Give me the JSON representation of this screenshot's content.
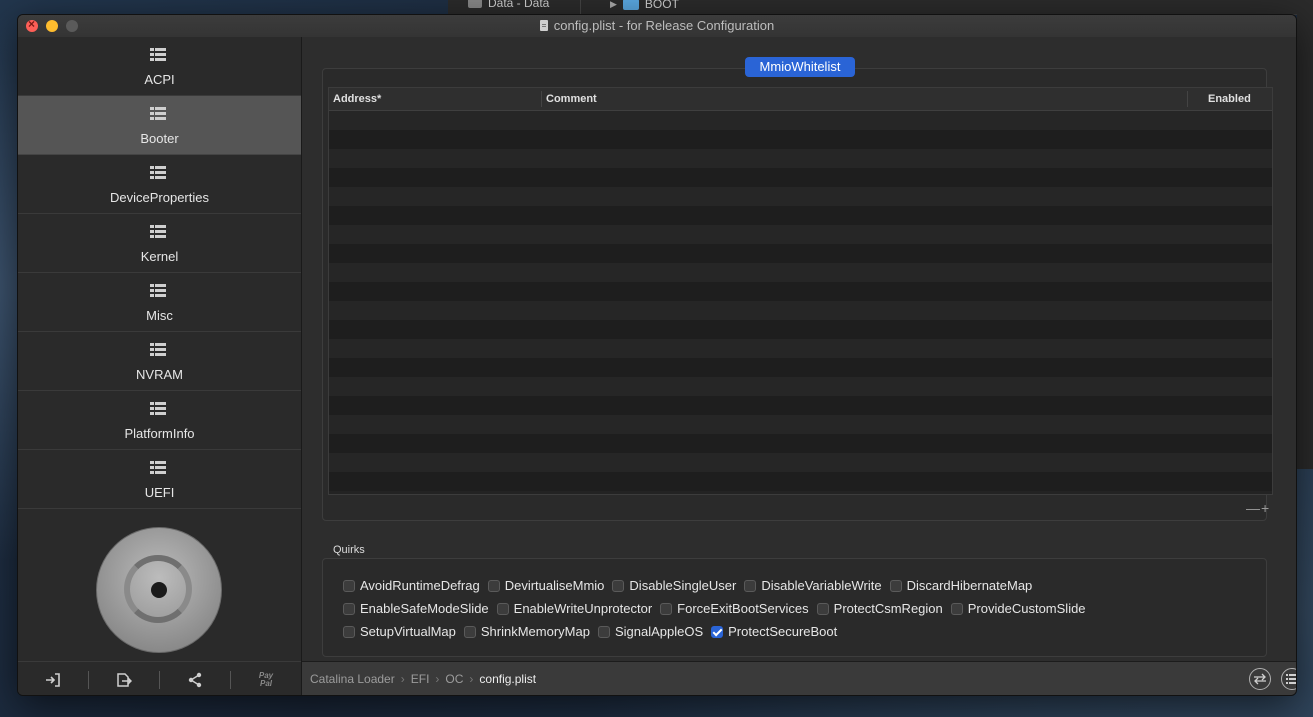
{
  "background": {
    "disk_label": "Data - Data",
    "folder_label": "BOOT"
  },
  "window": {
    "title": "config.plist - for Release Configuration"
  },
  "sidebar": {
    "items": [
      {
        "label": "ACPI"
      },
      {
        "label": "Booter"
      },
      {
        "label": "DeviceProperties"
      },
      {
        "label": "Kernel"
      },
      {
        "label": "Misc"
      },
      {
        "label": "NVRAM"
      },
      {
        "label": "PlatformInfo"
      },
      {
        "label": "UEFI"
      }
    ],
    "active_index": 1,
    "paypal_line1": "Pay",
    "paypal_line2": "Pal"
  },
  "main": {
    "segment_label": "MmioWhitelist",
    "table": {
      "columns": [
        "Address*",
        "Comment",
        "Enabled"
      ]
    },
    "minus_label": "—",
    "plus_label": "+",
    "quirks_title": "Quirks",
    "quirks": [
      [
        {
          "label": "AvoidRuntimeDefrag",
          "checked": false
        },
        {
          "label": "DevirtualiseMmio",
          "checked": false
        },
        {
          "label": "DisableSingleUser",
          "checked": false
        },
        {
          "label": "DisableVariableWrite",
          "checked": false
        },
        {
          "label": "DiscardHibernateMap",
          "checked": false
        }
      ],
      [
        {
          "label": "EnableSafeModeSlide",
          "checked": false
        },
        {
          "label": "EnableWriteUnprotector",
          "checked": false
        },
        {
          "label": "ForceExitBootServices",
          "checked": false
        },
        {
          "label": "ProtectCsmRegion",
          "checked": false
        },
        {
          "label": "ProvideCustomSlide",
          "checked": false
        }
      ],
      [
        {
          "label": "SetupVirtualMap",
          "checked": false
        },
        {
          "label": "ShrinkMemoryMap",
          "checked": false
        },
        {
          "label": "SignalAppleOS",
          "checked": false
        },
        {
          "label": "ProtectSecureBoot",
          "checked": true
        }
      ]
    ]
  },
  "statusbar": {
    "breadcrumb": [
      "Catalina Loader",
      "EFI",
      "OC",
      "config.plist"
    ]
  },
  "colors": {
    "accent": "#2a64d6",
    "active_sidebar": "#555555"
  }
}
